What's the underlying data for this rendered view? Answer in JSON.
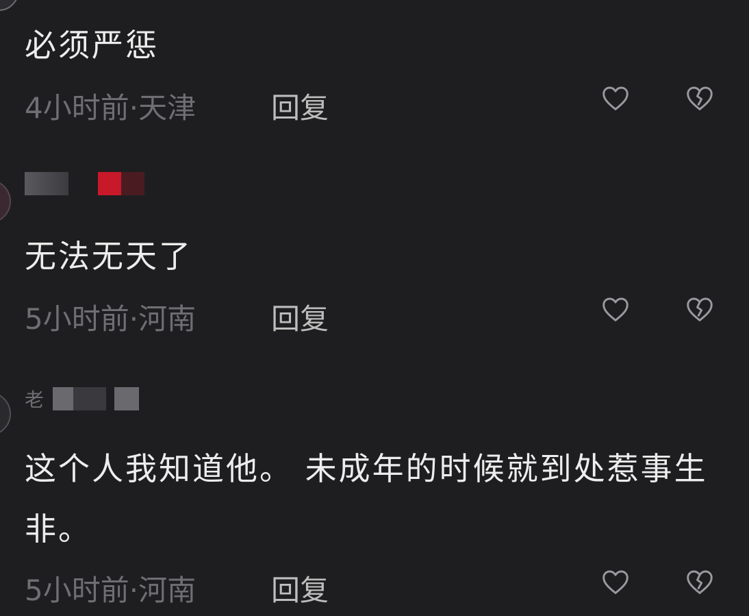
{
  "comments": [
    {
      "username": "",
      "text": "必须严惩",
      "time": "4小时前",
      "separator": "·",
      "location": "天津",
      "reply_label": "回复",
      "like_icon": "heart-outline-icon",
      "dislike_icon": "broken-heart-icon"
    },
    {
      "username": "",
      "text": "无法无天了",
      "time": "5小时前",
      "separator": "·",
      "location": "河南",
      "reply_label": "回复",
      "like_icon": "heart-outline-icon",
      "dislike_icon": "broken-heart-icon"
    },
    {
      "username": "老",
      "text": "这个人我知道他。  未成年的时候就到处惹事生非。",
      "time": "5小时前",
      "separator": "·",
      "location": "河南",
      "reply_label": "回复",
      "like_icon": "heart-outline-icon",
      "dislike_icon": "broken-heart-icon"
    }
  ],
  "colors": {
    "background": "#1e1e20",
    "text": "#ededed",
    "meta": "#6f6f73",
    "reply": "#bdbdbd",
    "icon": "#9a9a9e"
  }
}
